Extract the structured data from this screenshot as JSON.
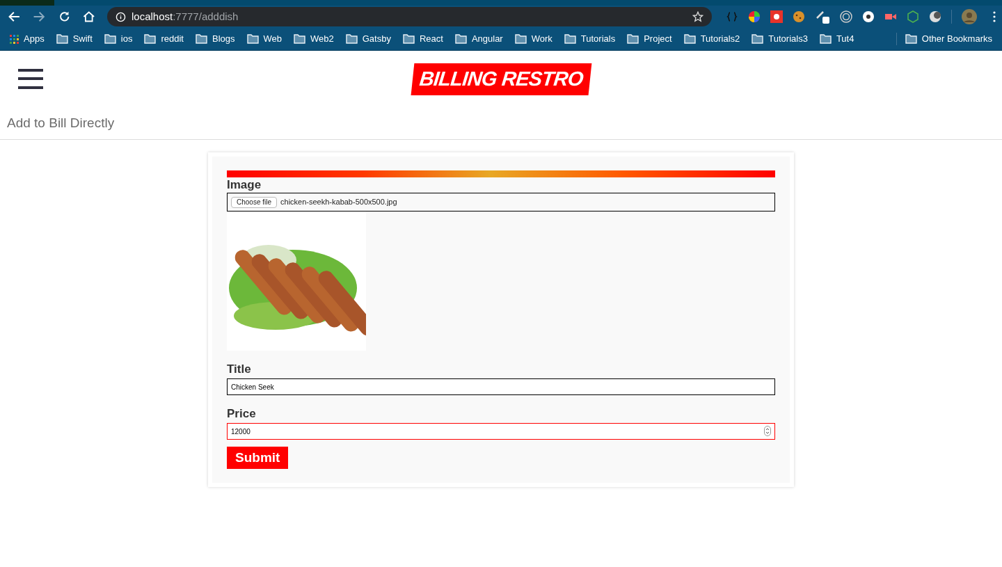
{
  "browser": {
    "url_host": "localhost",
    "url_path": ":7777/adddish",
    "bookmarks": [
      {
        "label": "Apps",
        "kind": "apps"
      },
      {
        "label": "Swift",
        "kind": "folder"
      },
      {
        "label": "ios",
        "kind": "folder"
      },
      {
        "label": "reddit",
        "kind": "folder"
      },
      {
        "label": "Blogs",
        "kind": "folder"
      },
      {
        "label": "Web",
        "kind": "folder"
      },
      {
        "label": "Web2",
        "kind": "folder"
      },
      {
        "label": "Gatsby",
        "kind": "folder"
      },
      {
        "label": "React",
        "kind": "folder"
      },
      {
        "label": "Angular",
        "kind": "folder"
      },
      {
        "label": "Work",
        "kind": "folder"
      },
      {
        "label": "Tutorials",
        "kind": "folder"
      },
      {
        "label": "Project",
        "kind": "folder"
      },
      {
        "label": "Tutorials2",
        "kind": "folder"
      },
      {
        "label": "Tutorials3",
        "kind": "folder"
      },
      {
        "label": "Tut4",
        "kind": "folder"
      }
    ],
    "other_bookmarks": "Other Bookmarks"
  },
  "header": {
    "logo": "BILLING RESTRO"
  },
  "page_title": "Add to Bill Directly",
  "form": {
    "image": {
      "label": "Image",
      "button": "Choose file",
      "file_name": "chicken-seekh-kabab-500x500.jpg"
    },
    "fields": [
      {
        "label": "Title",
        "value": "Chicken Seek",
        "kind": "text",
        "focused": false
      },
      {
        "label": "Price",
        "value": "12000",
        "kind": "number",
        "focused": true
      }
    ],
    "submit": "Submit"
  }
}
